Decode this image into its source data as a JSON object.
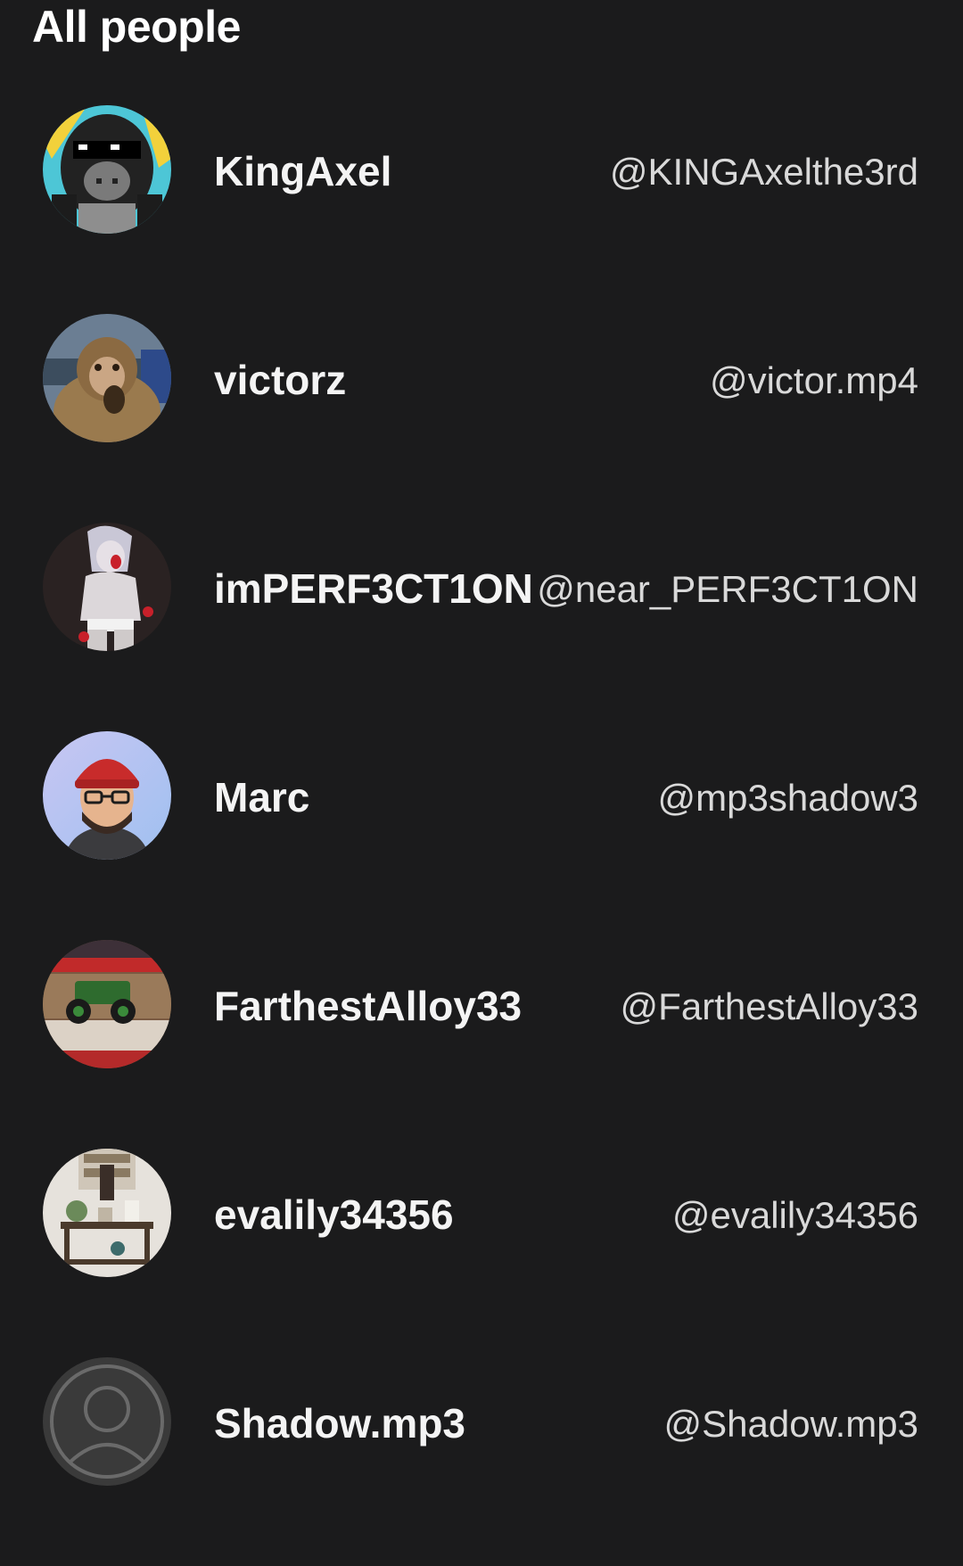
{
  "section": {
    "title": "All people"
  },
  "people": [
    {
      "name": "KingAxel",
      "handle": "@KINGAxelthe3rd",
      "avatar_icon": "gorilla-sunglasses-avatar"
    },
    {
      "name": "victorz",
      "handle": "@victor.mp4",
      "avatar_icon": "monkey-photo-avatar"
    },
    {
      "name": "imPERF3CT1ON",
      "handle": "@near_PERF3CT1ON",
      "avatar_icon": "anime-character-avatar"
    },
    {
      "name": "Marc",
      "handle": "@mp3shadow3",
      "avatar_icon": "cartoon-man-red-beanie-avatar"
    },
    {
      "name": "FarthestAlloy33",
      "handle": "@FarthestAlloy33",
      "avatar_icon": "monster-truck-photo-avatar"
    },
    {
      "name": "evalily34356",
      "handle": "@evalily34356",
      "avatar_icon": "room-interior-photo-avatar"
    },
    {
      "name": "Shadow.mp3",
      "handle": "@Shadow.mp3",
      "avatar_icon": "default-user-avatar"
    }
  ]
}
